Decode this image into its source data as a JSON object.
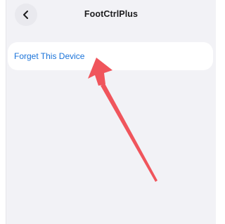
{
  "header": {
    "title": "FootCtrlPlus",
    "back_icon": "chevron-left-icon"
  },
  "device_options": {
    "forget_label": "Forget This Device"
  },
  "colors": {
    "background": "#f2f2f6",
    "link": "#1a73d9",
    "annotation": "#f0555c"
  }
}
